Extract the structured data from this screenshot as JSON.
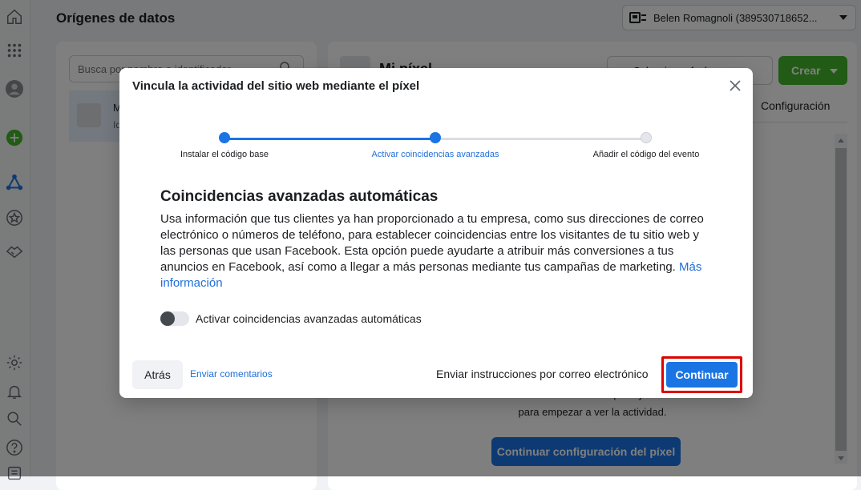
{
  "page": {
    "title": "Orígenes de datos"
  },
  "account": {
    "name": "Belen Romagnoli (389530718652..."
  },
  "left_panel": {
    "search_placeholder": "Busca por nombre o identificador",
    "item_title": "M",
    "item_subtitle": "Id"
  },
  "right_panel": {
    "name": "Mi píxel",
    "select_label": "Seleccionar fechas",
    "create_label": "Crear",
    "tab_label": "Configuración",
    "message": "web. Finaliza la instalación del píxel y añade eventos para empezar a ver la actividad.",
    "continue_setup_label": "Continuar configuración del píxel"
  },
  "modal": {
    "title": "Vincula la actividad del sitio web mediante el píxel",
    "steps": [
      {
        "label": "Instalar el código base",
        "state": "done"
      },
      {
        "label": "Activar coincidencias avanzadas",
        "state": "current"
      },
      {
        "label": "Añadir el código del evento",
        "state": "todo"
      }
    ],
    "heading": "Coincidencias avanzadas automáticas",
    "description": "Usa información que tus clientes ya han proporcionado a tu empresa, como sus direcciones de correo electrónico o números de teléfono, para establecer coincidencias entre los visitantes de tu sitio web y las personas que usan Facebook. Esta opción puede ayudarte a atribuir más conversiones a tus anuncios en Facebook, así como a llegar a más personas mediante tus campañas de marketing.",
    "more_info_link": "Más información",
    "toggle_label": "Activar coincidencias avanzadas automáticas",
    "toggle_on": false,
    "back_label": "Atrás",
    "feedback_link": "Enviar comentarios",
    "email_instructions_label": "Enviar instrucciones por correo electrónico",
    "continue_label": "Continuar"
  },
  "colors": {
    "primary": "#1b74e4",
    "link": "#216fdb",
    "create_green": "#42b72a",
    "highlight_red": "#e00000"
  }
}
